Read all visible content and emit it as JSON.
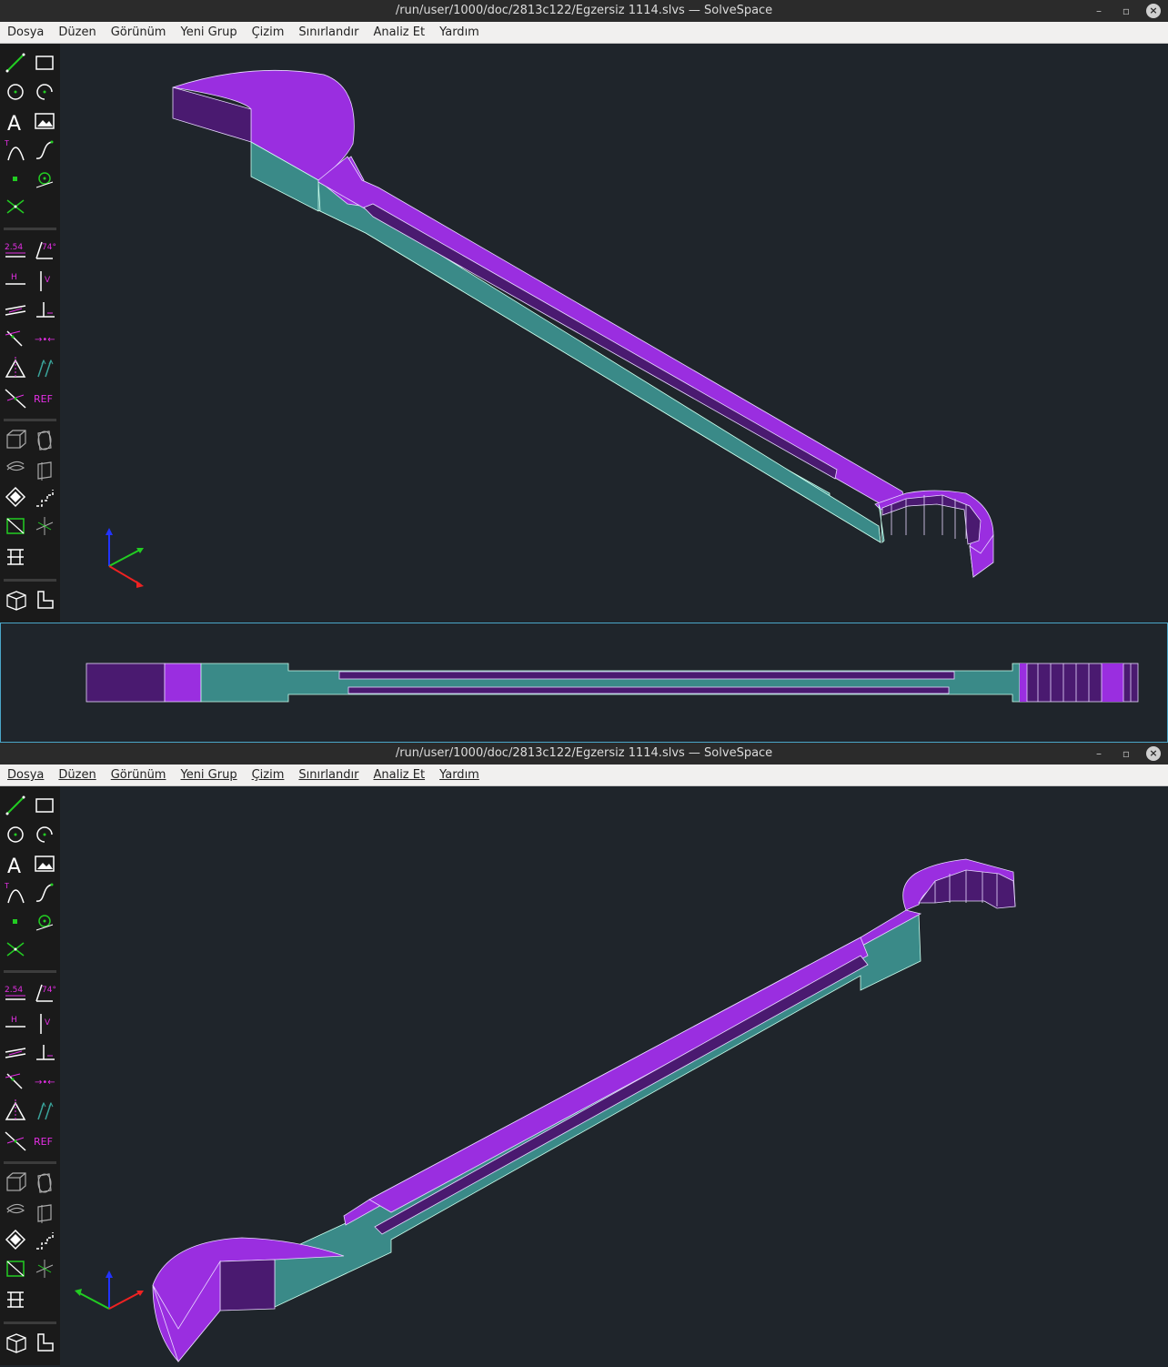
{
  "window1": {
    "title": "/run/user/1000/doc/2813c122/Egzersiz 1114.slvs — SolveSpace",
    "menu": [
      "Dosya",
      "Düzen",
      "Görünüm",
      "Yeni Grup",
      "Çizim",
      "Sınırlandır",
      "Analiz Et",
      "Yardım"
    ]
  },
  "window2": {
    "title": "/run/user/1000/doc/2813c122/Egzersiz 1114.slvs — SolveSpace",
    "menu": [
      "Dosya",
      "Düzen",
      "Görünüm",
      "Yeni Grup",
      "Çizim",
      "Sınırlandır",
      "Analiz Et",
      "Yardım"
    ]
  },
  "toolbar_labels": {
    "text_tool": "A",
    "distance": "2.54",
    "angle": "74°",
    "horizontal": "H",
    "vertical": "V",
    "reference": "REF"
  },
  "window_buttons": {
    "minimize": "–",
    "maximize": "▫",
    "close": "×"
  },
  "colors": {
    "model_top": "#9a2ee0",
    "model_dark": "#4a1a70",
    "model_side": "#3a8a88",
    "background": "#1f252b",
    "constraint": "#e22ee2",
    "sketch": "#22cc22"
  }
}
